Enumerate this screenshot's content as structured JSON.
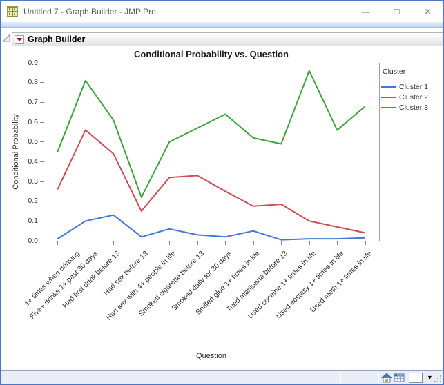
{
  "window": {
    "title": "Untitled 7 - Graph Builder - JMP Pro",
    "controls": {
      "minimize_glyph": "—",
      "maximize_glyph": "□",
      "close_glyph": "✕"
    }
  },
  "report": {
    "header_title": "Graph Builder"
  },
  "chart_data": {
    "type": "line",
    "title": "Conditional Probability vs. Question",
    "xlabel": "Question",
    "ylabel": "Conditional Probability",
    "ylim": [
      0,
      0.9
    ],
    "ytick_step": 0.1,
    "grid": false,
    "legend_title": "Cluster",
    "legend_position": "right",
    "categories": [
      "1+ times when drinking",
      "Five+ drinks 1+ past 30 days",
      "Had first drink before 13",
      "Had sex before 13",
      "Had sex with 4+ people in life",
      "Smoked cigarette before 13",
      "Smoked daily for 30 days",
      "Sniffed glue 1+ times in life",
      "Tried marijuana before 13",
      "Used cocaine 1+ times in life",
      "Used ecstasy 1+ times in life",
      "Used meth 1+ times in life"
    ],
    "series": [
      {
        "name": "Cluster 1",
        "color": "#4576d5",
        "values": [
          0.01,
          0.1,
          0.13,
          0.02,
          0.06,
          0.03,
          0.02,
          0.05,
          0.005,
          0.01,
          0.01,
          0.015
        ]
      },
      {
        "name": "Cluster 2",
        "color": "#cf4a52",
        "values": [
          0.26,
          0.56,
          0.44,
          0.15,
          0.32,
          0.33,
          0.25,
          0.175,
          0.185,
          0.1,
          0.07,
          0.04
        ]
      },
      {
        "name": "Cluster 3",
        "color": "#3ba53b",
        "values": [
          0.45,
          0.81,
          0.61,
          0.22,
          0.5,
          0.57,
          0.64,
          0.52,
          0.49,
          0.86,
          0.56,
          0.68
        ]
      }
    ]
  },
  "status_bar": {
    "dropdown_glyph": "▼"
  }
}
